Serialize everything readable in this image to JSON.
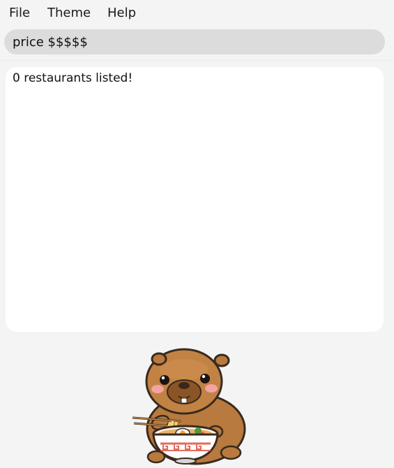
{
  "menu": {
    "file": "File",
    "theme": "Theme",
    "help": "Help"
  },
  "command": {
    "value": "price $$$$$"
  },
  "result": {
    "text": "0 restaurants listed!"
  },
  "mascot": {
    "icon": "capybara-eating-ramen-icon",
    "colors": {
      "fur": "#b87a3e",
      "fur_dark": "#8a5526",
      "cheek": "#f4a3a3",
      "bowl": "#ffffff",
      "bowl_pattern": "#e36b5b"
    }
  }
}
